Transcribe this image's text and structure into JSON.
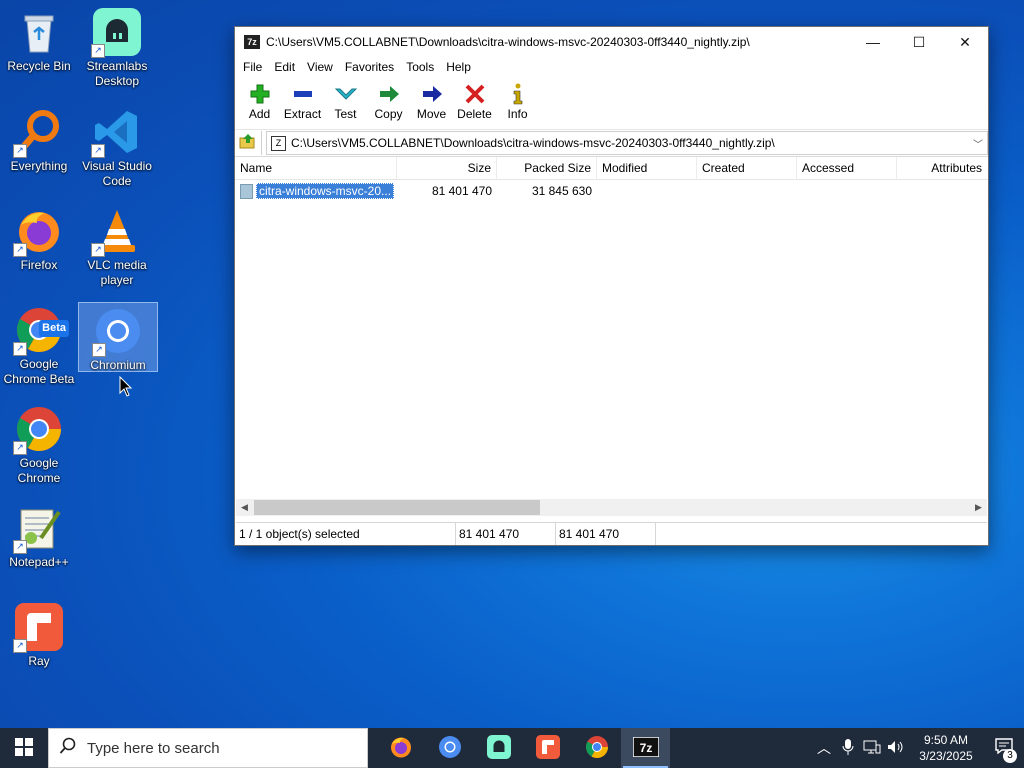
{
  "desktop": {
    "icons": [
      {
        "label": "Recycle Bin"
      },
      {
        "label": "Streamlabs Desktop"
      },
      {
        "label": "Everything"
      },
      {
        "label": "Visual Studio Code"
      },
      {
        "label": "Firefox"
      },
      {
        "label": "VLC media player"
      },
      {
        "label": "Google Chrome Beta"
      },
      {
        "label": "Chromium"
      },
      {
        "label": "Google Chrome"
      },
      {
        "label": "Notepad++"
      },
      {
        "label": "Ray"
      }
    ],
    "beta_badge": "Beta"
  },
  "window": {
    "app_icon": "7z",
    "title": "C:\\Users\\VM5.COLLABNET\\Downloads\\citra-windows-msvc-20240303-0ff3440_nightly.zip\\",
    "controls": {
      "minimize": "—",
      "maximize": "☐",
      "close": "✕"
    },
    "menu": [
      "File",
      "Edit",
      "View",
      "Favorites",
      "Tools",
      "Help"
    ],
    "toolbar": [
      {
        "label": "Add",
        "icon": "add-icon",
        "color": "#22b022"
      },
      {
        "label": "Extract",
        "icon": "extract-icon",
        "color": "#1a3fb8"
      },
      {
        "label": "Test",
        "icon": "test-icon",
        "color": "#28b4c8"
      },
      {
        "label": "Copy",
        "icon": "copy-icon",
        "color": "#1e8a3a"
      },
      {
        "label": "Move",
        "icon": "move-icon",
        "color": "#1a2aa0"
      },
      {
        "label": "Delete",
        "icon": "delete-icon",
        "color": "#d42020"
      },
      {
        "label": "Info",
        "icon": "info-icon",
        "color": "#c8a800"
      }
    ],
    "address": "C:\\Users\\VM5.COLLABNET\\Downloads\\citra-windows-msvc-20240303-0ff3440_nightly.zip\\",
    "columns": [
      "Name",
      "Size",
      "Packed Size",
      "Modified",
      "Created",
      "Accessed",
      "Attributes"
    ],
    "rows": [
      {
        "name": "citra-windows-msvc-20...",
        "size": "81 401 470",
        "packed": "31 845 630",
        "modified": "",
        "created": "",
        "accessed": "",
        "attributes": ""
      }
    ],
    "status": {
      "selection": "1 / 1 object(s) selected",
      "size": "81 401 470",
      "packed": "81 401 470"
    }
  },
  "taskbar": {
    "search_placeholder": "Type here to search",
    "apps": [
      "firefox",
      "chromium",
      "streamlabs",
      "ray",
      "chrome-beta",
      "7zip"
    ],
    "time": "9:50 AM",
    "date": "3/23/2025",
    "notifications": "3"
  }
}
